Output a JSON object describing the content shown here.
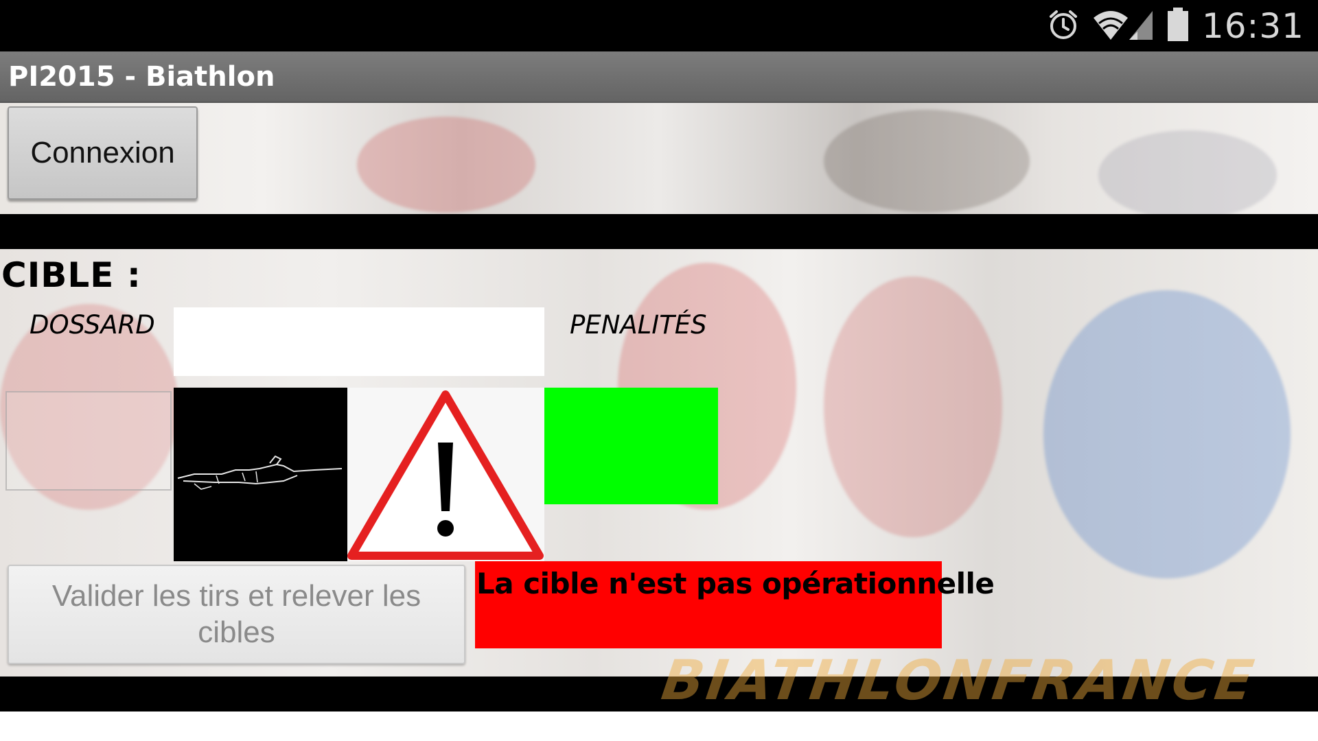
{
  "status_bar": {
    "time": "16:31",
    "icons": [
      "alarm-icon",
      "wifi-icon",
      "signal-icon",
      "battery-icon"
    ]
  },
  "action_bar": {
    "title": "PI2015 - Biathlon"
  },
  "header": {
    "connexion_label": "Connexion"
  },
  "target": {
    "cible_label": "CIBLE  :",
    "dossard_label": "DOSSARD",
    "penalites_label": "PENALITÉS",
    "dossard_value": "",
    "validate_label": "Valider les tirs et relever les cibles",
    "status_message": "La cible n'est pas opérationnelle",
    "penalty_indicator_color": "#00ff00",
    "status_color": "#ff0000",
    "watermark": "BIATHLONFRANCE"
  },
  "colors": {
    "action_bar": "#6e6e6e",
    "status_bar": "#000000"
  }
}
